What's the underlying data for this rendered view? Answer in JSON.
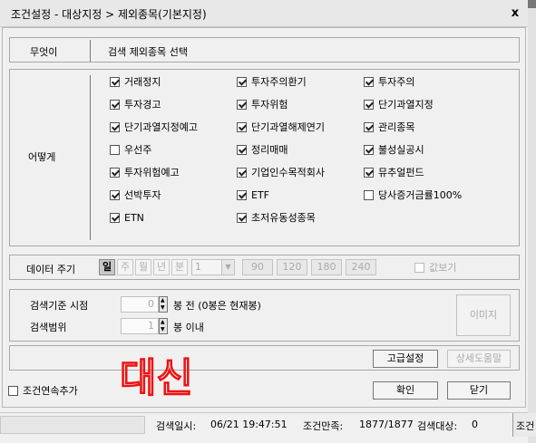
{
  "window": {
    "title": "조건설정 - 대상지정 > 제외종목(기본지정)",
    "close_glyph": "x"
  },
  "what": {
    "label": "무엇이",
    "value": "검색 제외종목 선택"
  },
  "how": {
    "label": "어떻게",
    "options": [
      {
        "label": "거래정지",
        "checked": true
      },
      {
        "label": "투자주의환기",
        "checked": true
      },
      {
        "label": "투자주의",
        "checked": true
      },
      {
        "label": "투자경고",
        "checked": true
      },
      {
        "label": "투자위험",
        "checked": true
      },
      {
        "label": "단기과열지정",
        "checked": true
      },
      {
        "label": "단기과열지정예고",
        "checked": true
      },
      {
        "label": "단기과열해제연기",
        "checked": true
      },
      {
        "label": "관리종목",
        "checked": true
      },
      {
        "label": "우선주",
        "checked": false
      },
      {
        "label": "정리매매",
        "checked": true
      },
      {
        "label": "불성실공시",
        "checked": true
      },
      {
        "label": "투자위험예고",
        "checked": true
      },
      {
        "label": "기업인수목적회사",
        "checked": true
      },
      {
        "label": "뮤추얼펀드",
        "checked": true
      },
      {
        "label": "선박투자",
        "checked": true
      },
      {
        "label": "ETF",
        "checked": true
      },
      {
        "label": "당사증거금률100%",
        "checked": false
      },
      {
        "label": "ETN",
        "checked": true
      },
      {
        "label": "초저유동성종목",
        "checked": true
      }
    ]
  },
  "period": {
    "label": "데이터 주기",
    "units": [
      "일",
      "주",
      "월",
      "년",
      "분"
    ],
    "selected_unit": "일",
    "minute_value": "1",
    "minute_buttons": [
      "90",
      "120",
      "180",
      "240"
    ],
    "fixed_label": "값보기",
    "fixed_checked": false
  },
  "criteria": {
    "base_label": "검색기준 시점",
    "base_value": "0",
    "base_unit": "봉 전 (0봉은 현재봉)",
    "range_label": "검색범위",
    "range_value": "1",
    "range_unit": "봉 이내",
    "image_button": "이미지"
  },
  "buttons": {
    "advanced": "고급설정",
    "help": "상세도움말",
    "ok": "확인",
    "close": "닫기",
    "continuous_label": "조건연속추가",
    "continuous_checked": false
  },
  "status": {
    "search_time_label": "검색일시:",
    "search_time": "06/21 19:47:51",
    "match_label": "조건만족:",
    "match_value": "1877/1877",
    "target_label": "검색대상:",
    "target_value": "0",
    "edge_text": "조건"
  },
  "annotation": {
    "handwritten_text": "대신",
    "color": "#ee1111"
  },
  "colors": {
    "accent_red": "#ee1111",
    "dialog_bg": "#f0f0f0"
  }
}
